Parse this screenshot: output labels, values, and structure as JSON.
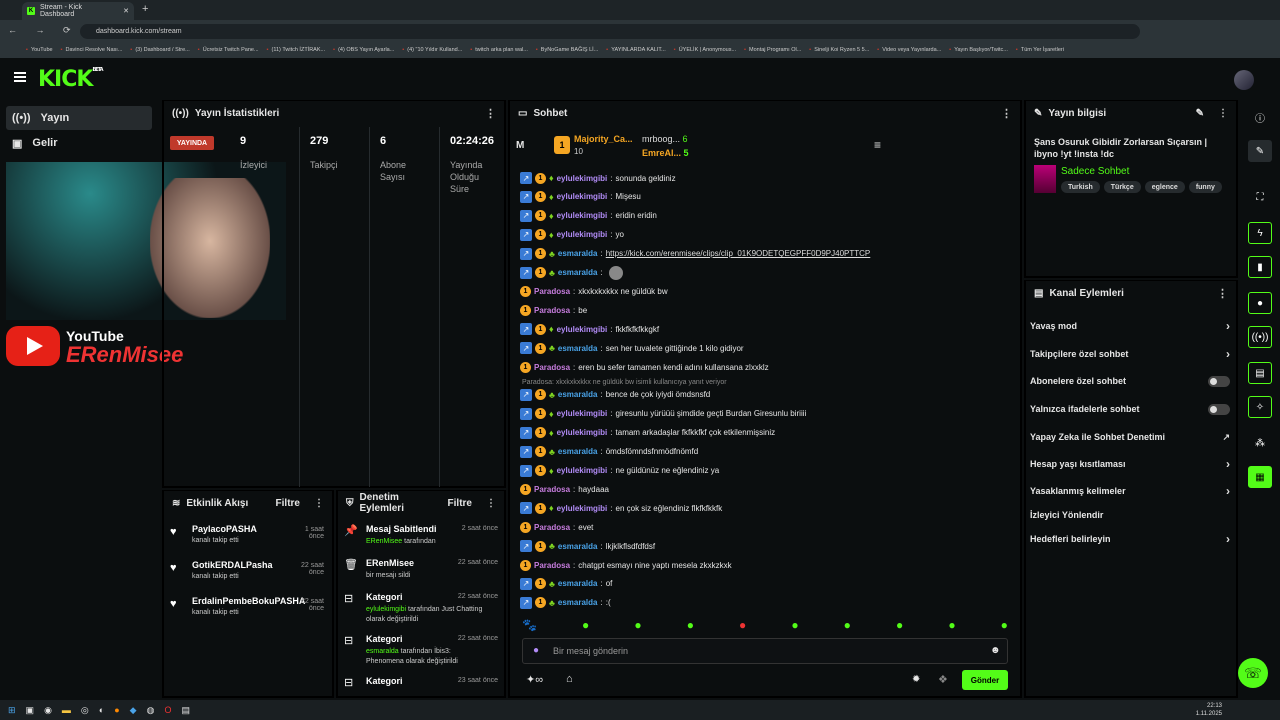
{
  "browser": {
    "tab_title": "Stream - Kick Dashboard",
    "url": "dashboard.kick.com/stream",
    "bookmarks": [
      "YouTube",
      "Davinci Resolve Nası...",
      "(3) Dashboard / Stre...",
      "Ücretsiz Twitch Pane...",
      "(11) Twitch İZTİRAK...",
      "(4) OBS Yayın Ayarla...",
      "(4) \"10 Yıldır Kulland...",
      "twitch arka plan wal...",
      "ByNoGame BAĞIŞ Lİ...",
      "YAYINLARDA KALIT...",
      "ÜYELİK | Anonymous...",
      "Montaj Programı Ol...",
      "Sinelji Koi Ryzen 5 5...",
      "Video veya Yayınlarda...",
      "Yayın Başlıyor/Twitc...",
      "Tüm Yer İşaretleri"
    ]
  },
  "brand": {
    "logo": "KICK",
    "beta": "BETA"
  },
  "nav": [
    {
      "label": "Yayın",
      "icon": "broadcast-icon"
    },
    {
      "label": "Gelir",
      "icon": "revenue-icon"
    }
  ],
  "stats": {
    "title": "Yayın İstatistikleri",
    "live": "YAYINDA",
    "items": [
      {
        "value": "9",
        "label": "İzleyici"
      },
      {
        "value": "279",
        "label": "Takipçi"
      },
      {
        "value": "6",
        "label": "Abone Sayısı"
      },
      {
        "value": "02:24:26",
        "label": "Yayında Olduğu Süre"
      }
    ]
  },
  "overlay": {
    "youtube": "YouTube",
    "name": "ERenMisee"
  },
  "activity": {
    "title": "Etkinlik Akışı",
    "filter": "Filtre",
    "items": [
      {
        "name": "PaylacoPASHA",
        "time": "1 saat önce",
        "sub": "kanalı takip etti"
      },
      {
        "name": "GotikERDALPasha",
        "time": "22 saat önce",
        "sub": "kanalı takip etti"
      },
      {
        "name": "ErdalinPembeBokuPASHA",
        "time": "22 saat önce",
        "sub": "kanalı takip etti"
      }
    ]
  },
  "moderation": {
    "title": "Denetim Eylemleri",
    "filter": "Filtre",
    "items": [
      {
        "name": "Mesaj Sabitlendi",
        "time": "2 saat önce",
        "sub_user": "ERenMisee",
        "sub_rest": " tarafından"
      },
      {
        "name": "ERenMisee",
        "time": "22 saat önce",
        "sub_user": "",
        "sub_rest": "bir mesajı sildi"
      },
      {
        "name": "Kategori",
        "time": "22 saat önce",
        "sub_user": "eylulekimgibi",
        "sub_rest": " tarafından Just Chatting olarak değiştirildi"
      },
      {
        "name": "Kategori",
        "time": "22 saat önce",
        "sub_user": "esmaralda",
        "sub_rest": " tarafından İbis3: Phenomena olarak değiştirildi"
      },
      {
        "name": "Kategori",
        "time": "23 saat önce",
        "sub_user": "",
        "sub_rest": ""
      }
    ]
  },
  "chat": {
    "title": "Sohbet",
    "top_letter": "M",
    "top1_name": "Majority_Ca...",
    "top1_count": "10",
    "top2_name": "mrboog...",
    "top2_count": "6",
    "top3_name": "EmreAl...",
    "top3_count": "5",
    "reply_note": "Paradosa: xkxkxkxkkx ne güldük bw isimli kullanıcıya yanıt veriyor",
    "placeholder": "Bir mesaj gönderin",
    "send": "Gönder",
    "messages": [
      {
        "user": "eylulekimgibi",
        "color": "#b28cf7",
        "badges": 3,
        "text": "sonunda geldiniz"
      },
      {
        "user": "eylulekimgibi",
        "color": "#b28cf7",
        "badges": 3,
        "text": "Mişesu"
      },
      {
        "user": "eylulekimgibi",
        "color": "#b28cf7",
        "badges": 3,
        "text": "eridin eridin"
      },
      {
        "user": "eylulekimgibi",
        "color": "#b28cf7",
        "badges": 3,
        "text": "yo"
      },
      {
        "user": "esmaralda",
        "color": "#4aa3e8",
        "badges": 3,
        "text": "https://kick.com/erenmisee/clips/clip_01K9ODETQEGPFF0D9PJ40PTTCP"
      },
      {
        "user": "esmaralda",
        "color": "#4aa3e8",
        "badges": 3,
        "text": ""
      },
      {
        "user": "Paradosa",
        "color": "#c77dde",
        "badges": 1,
        "text": "xkxkxkxkkx ne güldük bw"
      },
      {
        "user": "Paradosa",
        "color": "#c77dde",
        "badges": 1,
        "text": "be"
      },
      {
        "user": "eylulekimgibi",
        "color": "#b28cf7",
        "badges": 3,
        "text": "fkkfkfkfkkgkf"
      },
      {
        "user": "esmaralda",
        "color": "#4aa3e8",
        "badges": 3,
        "text": "sen her tuvalete gittiğinde 1 kilo gidiyor"
      },
      {
        "user": "Paradosa",
        "color": "#c77dde",
        "badges": 1,
        "text": "eren bu sefer tamamen kendi adını kullansana zlxxklz"
      },
      {
        "user": "esmaralda",
        "color": "#4aa3e8",
        "badges": 3,
        "text": "bence de çok iyiydi ömdsnsfd"
      },
      {
        "user": "eylulekimgibi",
        "color": "#b28cf7",
        "badges": 3,
        "text": "giresunlu yürüüü şimdide geçti Burdan Giresunlu biriiii"
      },
      {
        "user": "eylulekimgibi",
        "color": "#b28cf7",
        "badges": 3,
        "text": "tamam arkadaşlar fkfkkfkf çok etkilenmişsiniz"
      },
      {
        "user": "esmaralda",
        "color": "#4aa3e8",
        "badges": 3,
        "text": "ömdsfömndsfnmödfnömfd"
      },
      {
        "user": "eylulekimgibi",
        "color": "#b28cf7",
        "badges": 3,
        "text": "ne güldünüz ne eğlendiniz ya"
      },
      {
        "user": "Paradosa",
        "color": "#c77dde",
        "badges": 1,
        "text": "haydaaa"
      },
      {
        "user": "eylulekimgibi",
        "color": "#b28cf7",
        "badges": 3,
        "text": "en çok siz eğlendiniz flkfkfkkfk"
      },
      {
        "user": "Paradosa",
        "color": "#c77dde",
        "badges": 1,
        "text": "evet"
      },
      {
        "user": "esmaralda",
        "color": "#4aa3e8",
        "badges": 3,
        "text": "lkjklkflsdfdfdsf"
      },
      {
        "user": "Paradosa",
        "color": "#c77dde",
        "badges": 1,
        "text": "chatgpt esmayı nine yaptı mesela zkxkzkxk"
      },
      {
        "user": "esmaralda",
        "color": "#4aa3e8",
        "badges": 3,
        "text": "of"
      },
      {
        "user": "esmaralda",
        "color": "#4aa3e8",
        "badges": 3,
        "text": ":("
      }
    ]
  },
  "info": {
    "title": "Yayın bilgisi",
    "stream_title": "Şans Osuruk Gibidir Zorlarsan Sıçarsın | ibyno !yt !insta !dc",
    "category": "Sadece Sohbet",
    "tags": [
      "Turkish",
      "Türkçe",
      "eglence",
      "funny"
    ]
  },
  "channel": {
    "title": "Kanal Eylemleri",
    "rows": [
      {
        "label": "Yavaş mod",
        "kind": "arrow"
      },
      {
        "label": "Takipçilere özel sohbet",
        "kind": "arrow"
      },
      {
        "label": "Abonelere özel sohbet",
        "kind": "toggle"
      },
      {
        "label": "Yalnızca ifadelerle sohbet",
        "kind": "toggle"
      },
      {
        "label": "Yapay Zeka ile Sohbet Denetimi",
        "kind": "ext"
      },
      {
        "label": "Hesap yaşı kısıtlaması",
        "kind": "arrow"
      },
      {
        "label": "Yasaklanmış kelimeler",
        "kind": "arrow"
      },
      {
        "label": "İzleyici Yönlendir",
        "kind": "none"
      },
      {
        "label": "Hedefleri belirleyin",
        "kind": "arrow"
      }
    ]
  },
  "clock": {
    "time": "22:13",
    "date": "1.11.2025"
  },
  "colors": {
    "accent": "#53fc18",
    "live": "#c0392b"
  }
}
